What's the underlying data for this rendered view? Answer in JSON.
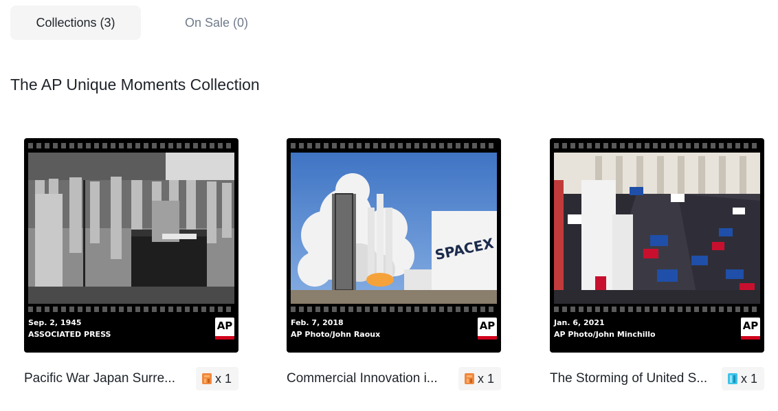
{
  "tabs": [
    {
      "label": "Collections (3)",
      "active": true
    },
    {
      "label": "On Sale (0)",
      "active": false
    }
  ],
  "section_title": "The AP Unique Moments Collection",
  "cards": [
    {
      "name": "Pacific War Japan Surre...",
      "caption_date": "Sep. 2, 1945",
      "caption_credit": "ASSOCIATED PRESS",
      "logo_text": "AP",
      "quantity": "x 1",
      "rarity_icon": "orange-rarity-icon",
      "rarity_color": "#f0883e"
    },
    {
      "name": "Commercial Innovation i...",
      "caption_date": "Feb. 7, 2018",
      "caption_credit": "AP Photo/John Raoux",
      "logo_text": "AP",
      "quantity": "x 1",
      "rarity_icon": "orange-rarity-icon",
      "rarity_color": "#f0883e"
    },
    {
      "name": "The Storming of United S...",
      "caption_date": "Jan. 6, 2021",
      "caption_credit": "AP Photo/John Minchillo",
      "logo_text": "AP",
      "quantity": "x 1",
      "rarity_icon": "blue-rarity-icon",
      "rarity_color": "#3ec3e8"
    }
  ]
}
